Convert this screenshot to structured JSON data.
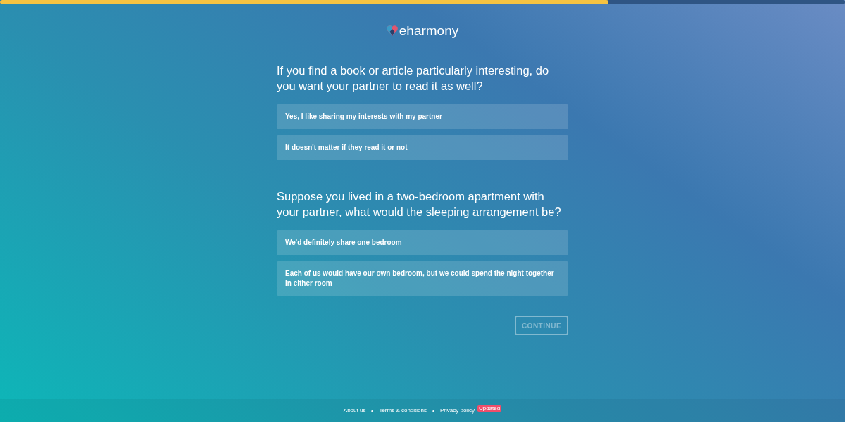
{
  "progress": {
    "level": 0.72
  },
  "logo": {
    "text": "eharmony"
  },
  "questions": [
    {
      "text": "If you find a book or article particularly interesting, do you want your partner to read it as well?",
      "options": [
        "Yes, I like sharing my interests with my partner",
        "It doesn't matter if they read it or not"
      ]
    },
    {
      "text": "Suppose you lived in a two-bedroom apartment with your partner, what would the sleeping arrangement be?",
      "options": [
        "We'd definitely share one bedroom",
        "Each of us would have our own bedroom, but we could spend the night together in either room"
      ]
    }
  ],
  "continue_button": {
    "label": "CONTINUE",
    "disabled": true
  },
  "footer": {
    "links": [
      "About us",
      "Terms & conditions",
      "Privacy policy"
    ],
    "badge": "Updated"
  }
}
